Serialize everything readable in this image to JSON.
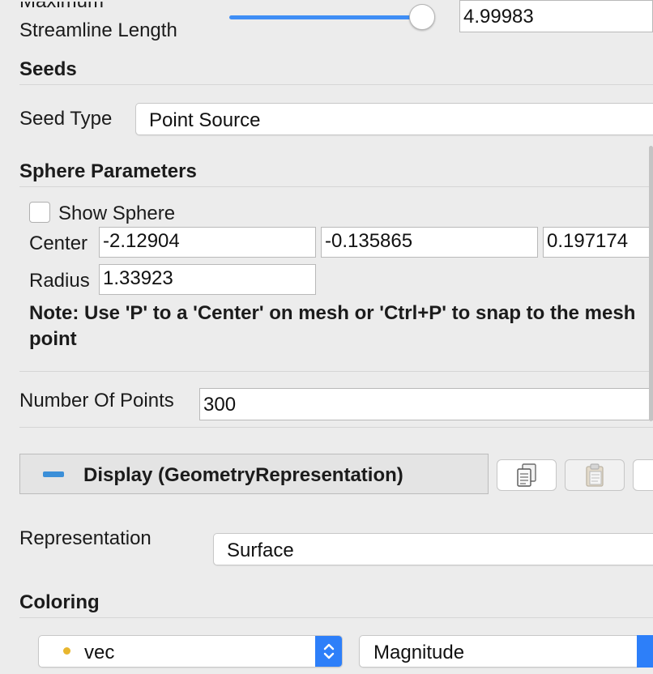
{
  "streamline": {
    "label_line1": "Maximum",
    "label_line2": "Streamline Length",
    "slider_value": 1.0,
    "value": "4.99983"
  },
  "seeds": {
    "section_title": "Seeds",
    "seed_type_label": "Seed Type",
    "seed_type_value": "Point Source"
  },
  "sphere": {
    "section_title": "Sphere Parameters",
    "show_sphere_label": "Show Sphere",
    "show_sphere_checked": false,
    "center_label": "Center",
    "center": [
      "-2.12904",
      "-0.135865",
      "0.197174"
    ],
    "radius_label": "Radius",
    "radius": "1.33923",
    "note": "Note: Use 'P' to a 'Center' on mesh or 'Ctrl+P' to snap to the mesh point"
  },
  "points": {
    "label": "Number Of Points",
    "value": "300"
  },
  "display": {
    "title": "Display (GeometryRepresentation)",
    "copy_icon": "copy-icon",
    "paste_icon": "paste-icon"
  },
  "representation": {
    "label": "Representation",
    "value": "Surface"
  },
  "coloring": {
    "section_title": "Coloring",
    "array": "vec",
    "component": "Magnitude",
    "accent": "#2d7ff9",
    "dot_color": "#e8b62e"
  }
}
